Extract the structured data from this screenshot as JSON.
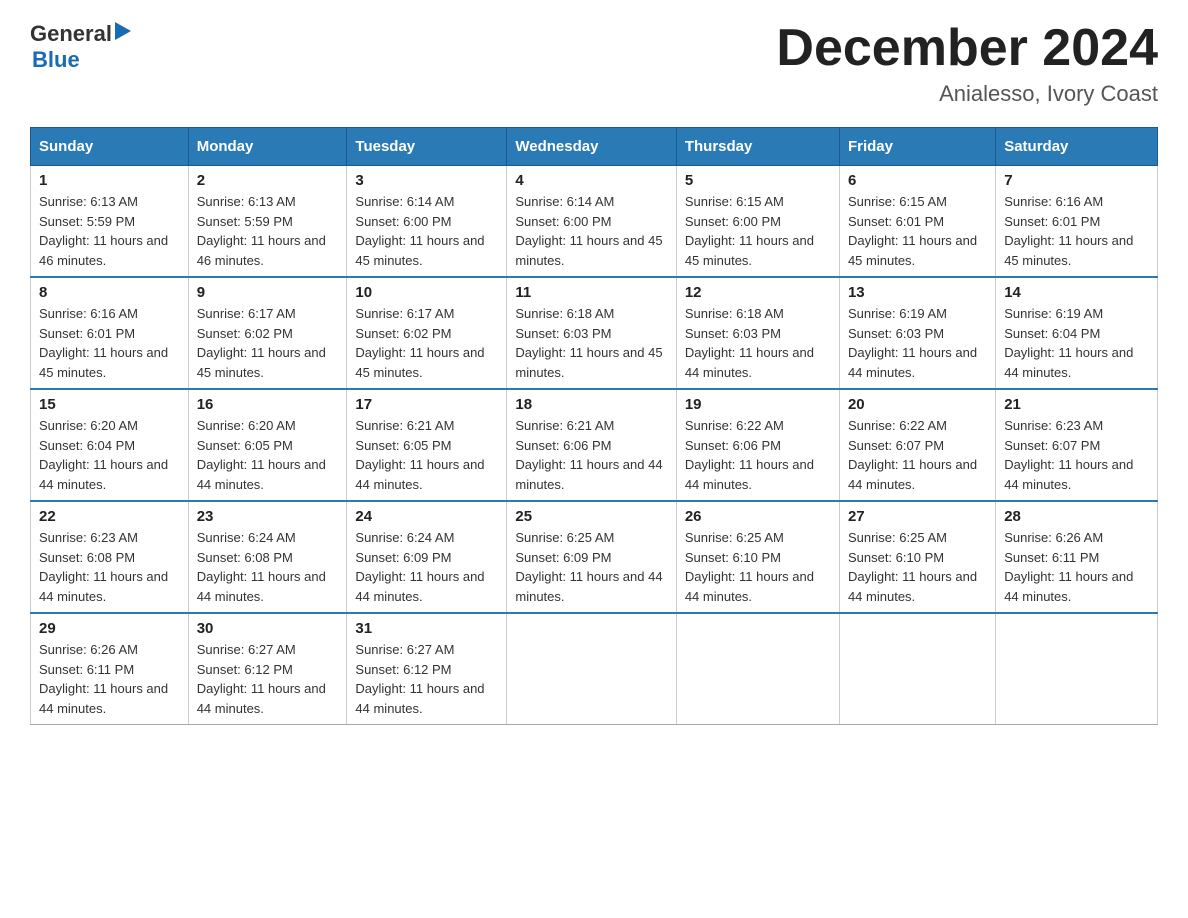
{
  "header": {
    "logo_general": "General",
    "logo_blue": "Blue",
    "title": "December 2024",
    "subtitle": "Anialesso, Ivory Coast"
  },
  "calendar": {
    "headers": [
      "Sunday",
      "Monday",
      "Tuesday",
      "Wednesday",
      "Thursday",
      "Friday",
      "Saturday"
    ],
    "weeks": [
      [
        {
          "day": "1",
          "sunrise": "6:13 AM",
          "sunset": "5:59 PM",
          "daylight": "11 hours and 46 minutes."
        },
        {
          "day": "2",
          "sunrise": "6:13 AM",
          "sunset": "5:59 PM",
          "daylight": "11 hours and 46 minutes."
        },
        {
          "day": "3",
          "sunrise": "6:14 AM",
          "sunset": "6:00 PM",
          "daylight": "11 hours and 45 minutes."
        },
        {
          "day": "4",
          "sunrise": "6:14 AM",
          "sunset": "6:00 PM",
          "daylight": "11 hours and 45 minutes."
        },
        {
          "day": "5",
          "sunrise": "6:15 AM",
          "sunset": "6:00 PM",
          "daylight": "11 hours and 45 minutes."
        },
        {
          "day": "6",
          "sunrise": "6:15 AM",
          "sunset": "6:01 PM",
          "daylight": "11 hours and 45 minutes."
        },
        {
          "day": "7",
          "sunrise": "6:16 AM",
          "sunset": "6:01 PM",
          "daylight": "11 hours and 45 minutes."
        }
      ],
      [
        {
          "day": "8",
          "sunrise": "6:16 AM",
          "sunset": "6:01 PM",
          "daylight": "11 hours and 45 minutes."
        },
        {
          "day": "9",
          "sunrise": "6:17 AM",
          "sunset": "6:02 PM",
          "daylight": "11 hours and 45 minutes."
        },
        {
          "day": "10",
          "sunrise": "6:17 AM",
          "sunset": "6:02 PM",
          "daylight": "11 hours and 45 minutes."
        },
        {
          "day": "11",
          "sunrise": "6:18 AM",
          "sunset": "6:03 PM",
          "daylight": "11 hours and 45 minutes."
        },
        {
          "day": "12",
          "sunrise": "6:18 AM",
          "sunset": "6:03 PM",
          "daylight": "11 hours and 44 minutes."
        },
        {
          "day": "13",
          "sunrise": "6:19 AM",
          "sunset": "6:03 PM",
          "daylight": "11 hours and 44 minutes."
        },
        {
          "day": "14",
          "sunrise": "6:19 AM",
          "sunset": "6:04 PM",
          "daylight": "11 hours and 44 minutes."
        }
      ],
      [
        {
          "day": "15",
          "sunrise": "6:20 AM",
          "sunset": "6:04 PM",
          "daylight": "11 hours and 44 minutes."
        },
        {
          "day": "16",
          "sunrise": "6:20 AM",
          "sunset": "6:05 PM",
          "daylight": "11 hours and 44 minutes."
        },
        {
          "day": "17",
          "sunrise": "6:21 AM",
          "sunset": "6:05 PM",
          "daylight": "11 hours and 44 minutes."
        },
        {
          "day": "18",
          "sunrise": "6:21 AM",
          "sunset": "6:06 PM",
          "daylight": "11 hours and 44 minutes."
        },
        {
          "day": "19",
          "sunrise": "6:22 AM",
          "sunset": "6:06 PM",
          "daylight": "11 hours and 44 minutes."
        },
        {
          "day": "20",
          "sunrise": "6:22 AM",
          "sunset": "6:07 PM",
          "daylight": "11 hours and 44 minutes."
        },
        {
          "day": "21",
          "sunrise": "6:23 AM",
          "sunset": "6:07 PM",
          "daylight": "11 hours and 44 minutes."
        }
      ],
      [
        {
          "day": "22",
          "sunrise": "6:23 AM",
          "sunset": "6:08 PM",
          "daylight": "11 hours and 44 minutes."
        },
        {
          "day": "23",
          "sunrise": "6:24 AM",
          "sunset": "6:08 PM",
          "daylight": "11 hours and 44 minutes."
        },
        {
          "day": "24",
          "sunrise": "6:24 AM",
          "sunset": "6:09 PM",
          "daylight": "11 hours and 44 minutes."
        },
        {
          "day": "25",
          "sunrise": "6:25 AM",
          "sunset": "6:09 PM",
          "daylight": "11 hours and 44 minutes."
        },
        {
          "day": "26",
          "sunrise": "6:25 AM",
          "sunset": "6:10 PM",
          "daylight": "11 hours and 44 minutes."
        },
        {
          "day": "27",
          "sunrise": "6:25 AM",
          "sunset": "6:10 PM",
          "daylight": "11 hours and 44 minutes."
        },
        {
          "day": "28",
          "sunrise": "6:26 AM",
          "sunset": "6:11 PM",
          "daylight": "11 hours and 44 minutes."
        }
      ],
      [
        {
          "day": "29",
          "sunrise": "6:26 AM",
          "sunset": "6:11 PM",
          "daylight": "11 hours and 44 minutes."
        },
        {
          "day": "30",
          "sunrise": "6:27 AM",
          "sunset": "6:12 PM",
          "daylight": "11 hours and 44 minutes."
        },
        {
          "day": "31",
          "sunrise": "6:27 AM",
          "sunset": "6:12 PM",
          "daylight": "11 hours and 44 minutes."
        },
        null,
        null,
        null,
        null
      ]
    ]
  }
}
